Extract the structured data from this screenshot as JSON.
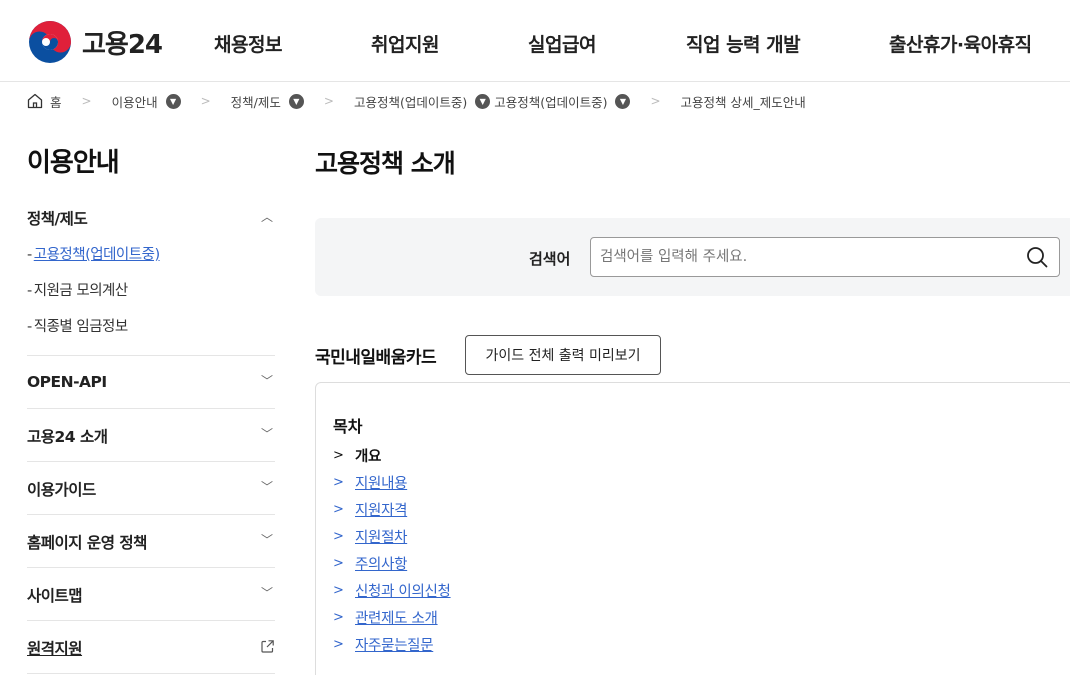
{
  "header": {
    "logo_text": "고용24",
    "nav": [
      "채용정보",
      "취업지원",
      "실업급여",
      "직업 능력 개발",
      "출산휴가·육아휴직"
    ]
  },
  "breadcrumb": {
    "home": "홈",
    "items": [
      "이용안내",
      "정책/제도",
      "고용정책(업데이트중)",
      "고용정책(업데이트중)",
      "고용정책 상세_제도안내"
    ]
  },
  "sidebar": {
    "title": "이용안내",
    "groups": [
      {
        "label": "정책/제도",
        "expanded": true
      },
      {
        "label": "OPEN-API"
      },
      {
        "label": "고용24 소개"
      },
      {
        "label": "이용가이드"
      },
      {
        "label": "홈페이지 운영 정책"
      },
      {
        "label": "사이트맵"
      },
      {
        "label": "원격지원"
      }
    ],
    "sub_items": [
      "고용정책(업데이트중)",
      "지원금 모의계산",
      "직종별 임금정보"
    ],
    "dash": "-"
  },
  "main": {
    "title": "고용정책 소개",
    "search": {
      "label": "검색어",
      "placeholder": "검색어를 입력해 주세요."
    },
    "section_title": "국민내일배움카드",
    "guide_button": "가이드 전체 출력 미리보기",
    "toc": {
      "title": "목차",
      "items": [
        "개요",
        "지원내용",
        "지원자격",
        "지원절차",
        "주의사항",
        "신청과 이의신청",
        "관련제도 소개",
        "자주묻는질문"
      ]
    }
  },
  "colors": {
    "link": "#3366cc",
    "search_bg": "#f4f5f6",
    "border": "#e5e5e5"
  }
}
